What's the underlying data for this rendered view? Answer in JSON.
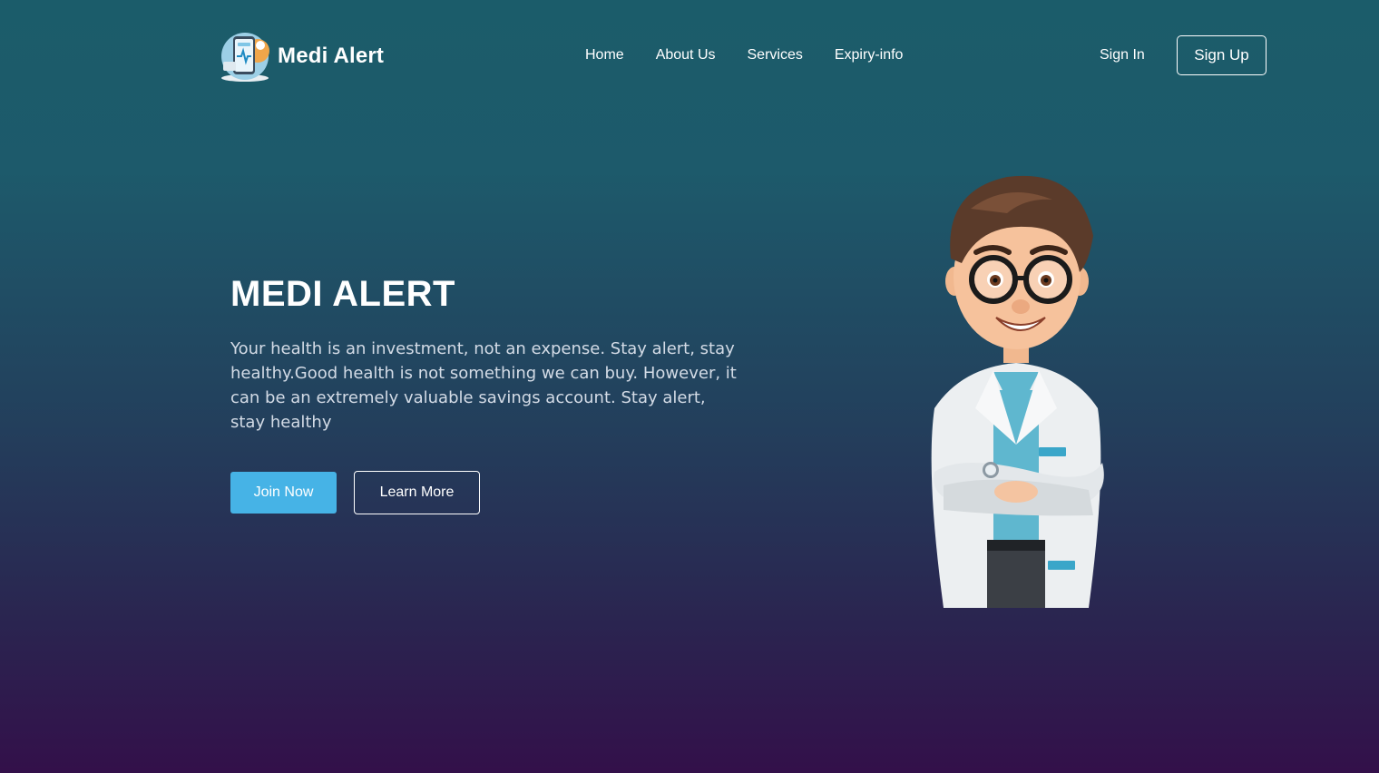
{
  "header": {
    "logo_text": "Medi Alert",
    "nav": [
      "Home",
      "About Us",
      "Services",
      "Expiry-info"
    ],
    "signin_label": "Sign In",
    "signup_label": "Sign Up"
  },
  "hero": {
    "title": "MEDI ALERT",
    "text": "Your health is an investment, not an expense. Stay alert, stay healthy.Good health is not something we can buy. However, it can be an extremely valuable savings account. Stay alert, stay healthy",
    "join_label": "Join Now",
    "learn_label": "Learn More"
  },
  "colors": {
    "accent": "#46b3e6",
    "bg_top": "#1b5c6a",
    "bg_bottom": "#33104a"
  },
  "icons": {
    "logo": "medical-phone-logo-icon",
    "illustration": "doctor-character"
  }
}
